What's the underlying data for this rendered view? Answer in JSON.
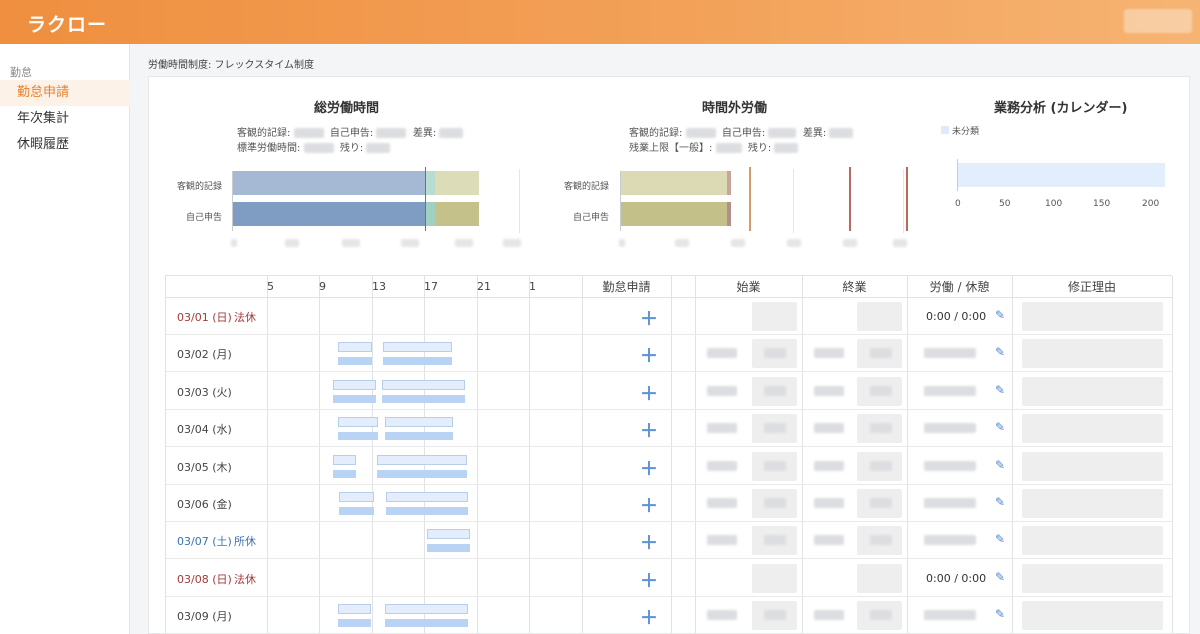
{
  "header": {
    "logo": "ラクロー",
    "user_label": ""
  },
  "sidebar": {
    "section": "勤怠",
    "items": [
      {
        "label": "勤怠申請",
        "active": true
      },
      {
        "label": "年次集計",
        "active": false
      },
      {
        "label": "休暇履歴",
        "active": false
      }
    ]
  },
  "regime": "労働時間制度: フレックスタイム制度",
  "total_hours": {
    "title": "総労働時間",
    "objective_label": "客観的記録:",
    "self_label": "自己申告:",
    "diff_label": "差異:",
    "standard_label": "標準労働時間:",
    "remaining_label": "残り:",
    "row_objective": "客観的記録",
    "row_self": "自己申告"
  },
  "overtime": {
    "title": "時間外労働",
    "objective_label": "客観的記録:",
    "self_label": "自己申告:",
    "diff_label": "差異:",
    "limit_label": "残業上限【一般】:",
    "remaining_label": "残り:",
    "row_objective": "客観的記録",
    "row_self": "自己申告"
  },
  "analysis": {
    "title": "業務分析 (カレンダー)",
    "legend": "未分類",
    "axis": [
      "0",
      "50",
      "100",
      "150",
      "200"
    ]
  },
  "table": {
    "timeline_hours": [
      "5",
      "9",
      "13",
      "17",
      "21",
      "1"
    ],
    "headers": {
      "request": "勤怠申請",
      "start": "始業",
      "end": "終業",
      "work_break": "労働 / 休憩",
      "reason": "修正理由"
    },
    "rows": [
      {
        "date": "03/01 (日)",
        "tag": "法休",
        "type": "holiday",
        "work": "0:00 / 0:00"
      },
      {
        "date": "03/02 (月)",
        "tag": "",
        "type": "normal",
        "work": ""
      },
      {
        "date": "03/03 (火)",
        "tag": "",
        "type": "normal",
        "work": ""
      },
      {
        "date": "03/04 (水)",
        "tag": "",
        "type": "normal",
        "work": ""
      },
      {
        "date": "03/05 (木)",
        "tag": "",
        "type": "normal",
        "work": ""
      },
      {
        "date": "03/06 (金)",
        "tag": "",
        "type": "normal",
        "work": ""
      },
      {
        "date": "03/07 (土)",
        "tag": "所休",
        "type": "sat",
        "work": ""
      },
      {
        "date": "03/08 (日)",
        "tag": "法休",
        "type": "holiday",
        "work": "0:00 / 0:00"
      },
      {
        "date": "03/09 (月)",
        "tag": "",
        "type": "normal",
        "work": ""
      }
    ],
    "plus_icon": "＋",
    "pencil_icon": "✎"
  },
  "colors": {
    "header_start": "#ef8f3f",
    "sidebar_active": "#e8812e",
    "holiday": "#a33a3a",
    "saturday": "#3a72b0"
  }
}
